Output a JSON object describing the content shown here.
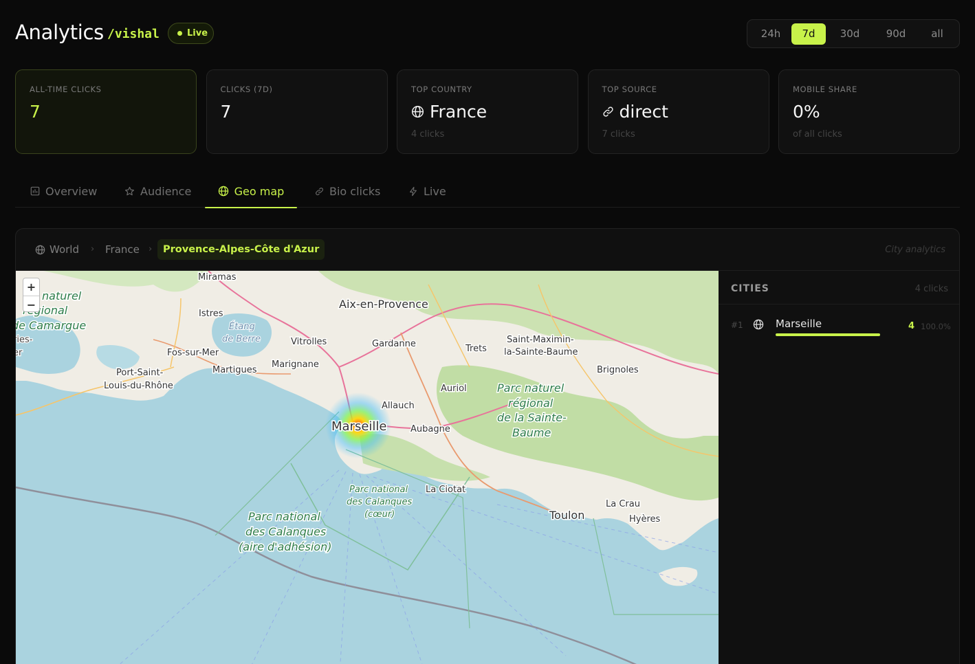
{
  "header": {
    "title": "Analytics",
    "handle": "/vishal",
    "live_label": "Live"
  },
  "ranges": [
    "24h",
    "7d",
    "30d",
    "90d",
    "all"
  ],
  "active_range": "7d",
  "cards": [
    {
      "label": "ALL-TIME CLICKS",
      "value": "7",
      "sub": ""
    },
    {
      "label": "CLICKS (7D)",
      "value": "7",
      "sub": ""
    },
    {
      "label": "TOP COUNTRY",
      "value": "France",
      "sub": "4 clicks",
      "icon": "globe-icon"
    },
    {
      "label": "TOP SOURCE",
      "value": "direct",
      "sub": "7 clicks",
      "icon": "link-icon"
    },
    {
      "label": "MOBILE SHARE",
      "value": "0%",
      "sub": "of all clicks"
    }
  ],
  "tabs": [
    {
      "label": "Overview",
      "icon": "bar-chart-icon"
    },
    {
      "label": "Audience",
      "icon": "star-icon"
    },
    {
      "label": "Geo map",
      "icon": "globe-icon"
    },
    {
      "label": "Bio clicks",
      "icon": "link-icon"
    },
    {
      "label": "Live",
      "icon": "lightning-icon"
    }
  ],
  "active_tab": "Geo map",
  "breadcrumb": [
    "World",
    "France",
    "Provence-Alpes-Côte d'Azur"
  ],
  "breadcrumb_note": "City analytics",
  "map": {
    "labels": {
      "miramas": "Miramas",
      "aix": "Aix-en-Provence",
      "istres": "Istres",
      "etang1": "Étang",
      "etang2": "de Berre",
      "vitrolles": "Vitrolles",
      "gardanne": "Gardanne",
      "trets": "Trets",
      "stmax1": "Saint-Maximin-",
      "stmax2": "la-Sainte-Baume",
      "brignoles": "Brignoles",
      "fos": "Fos-sur-Mer",
      "marignane": "Marignane",
      "martigues": "Martigues",
      "portst1": "Port-Saint-",
      "portst2": "Louis-du-Rhône",
      "auriol": "Auriol",
      "allauch": "Allauch",
      "marseille": "Marseille",
      "aubagne": "Aubagne",
      "pnr1": "Parc naturel",
      "pnr2": "régional",
      "pnr3": "de la Sainte-",
      "pnr4": "Baume",
      "camargue1": "naturel",
      "camargue2": "régional",
      "camargue3": "de Camargue",
      "saintes1": "ries-",
      "saintes2": "er",
      "cal1": "Parc national",
      "cal2": "des Calanques",
      "cal3": "(cœur)",
      "laciotat": "La Ciotat",
      "adh1": "Parc national",
      "adh2": "des Calanques",
      "adh3": "(aire d'adhésion)",
      "toulon": "Toulon",
      "lacrau": "La Crau",
      "hyeres": "Hyères"
    },
    "zoom_in": "+",
    "zoom_out": "−"
  },
  "cities": {
    "title": "CITIES",
    "count_label": "4 clicks",
    "rows": [
      {
        "rank": "#1",
        "name": "Marseille",
        "clicks": "4",
        "pct": "100.0%",
        "share": 1.0
      }
    ]
  },
  "colors": {
    "accent": "#c8f24a",
    "sea": "#aad3df",
    "land": "#f2efe9"
  }
}
